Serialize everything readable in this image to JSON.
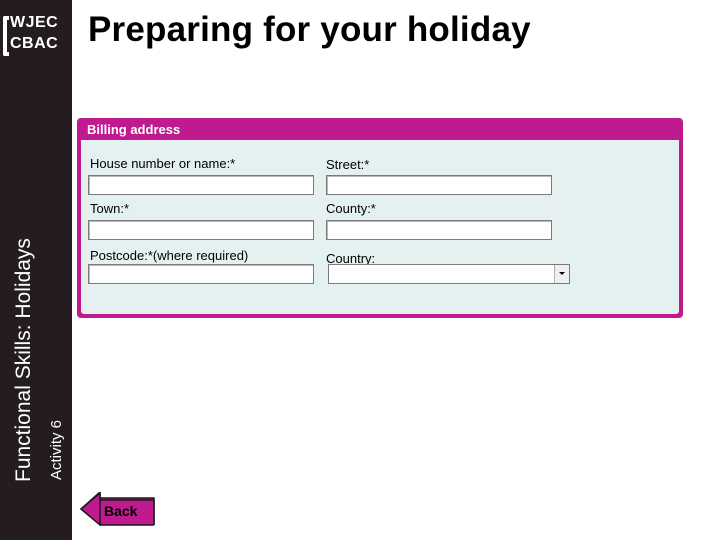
{
  "branding": {
    "logo_line1": "WJEC",
    "logo_line2": "CBAC"
  },
  "sidebar": {
    "title": "Functional Skills: Holidays",
    "activity": "Activity 6"
  },
  "page_title": "Preparing for your holiday",
  "billing": {
    "header": "Billing address",
    "house_label": "House number or name:*",
    "street_label": "Street:*",
    "town_label": "Town:*",
    "county_label": "County:*",
    "postcode_label": "Postcode:*(where required)",
    "country_label": "Country:",
    "house_value": "",
    "street_value": "",
    "town_value": "",
    "county_value": "",
    "postcode_value": "",
    "country_value": ""
  },
  "navigation": {
    "back_label": "Back"
  },
  "colors": {
    "sidebar": "#241c1e",
    "panel_border": "#c01a8f",
    "panel_fill": "#e4f1f0",
    "back_button": "#c01a8f"
  }
}
